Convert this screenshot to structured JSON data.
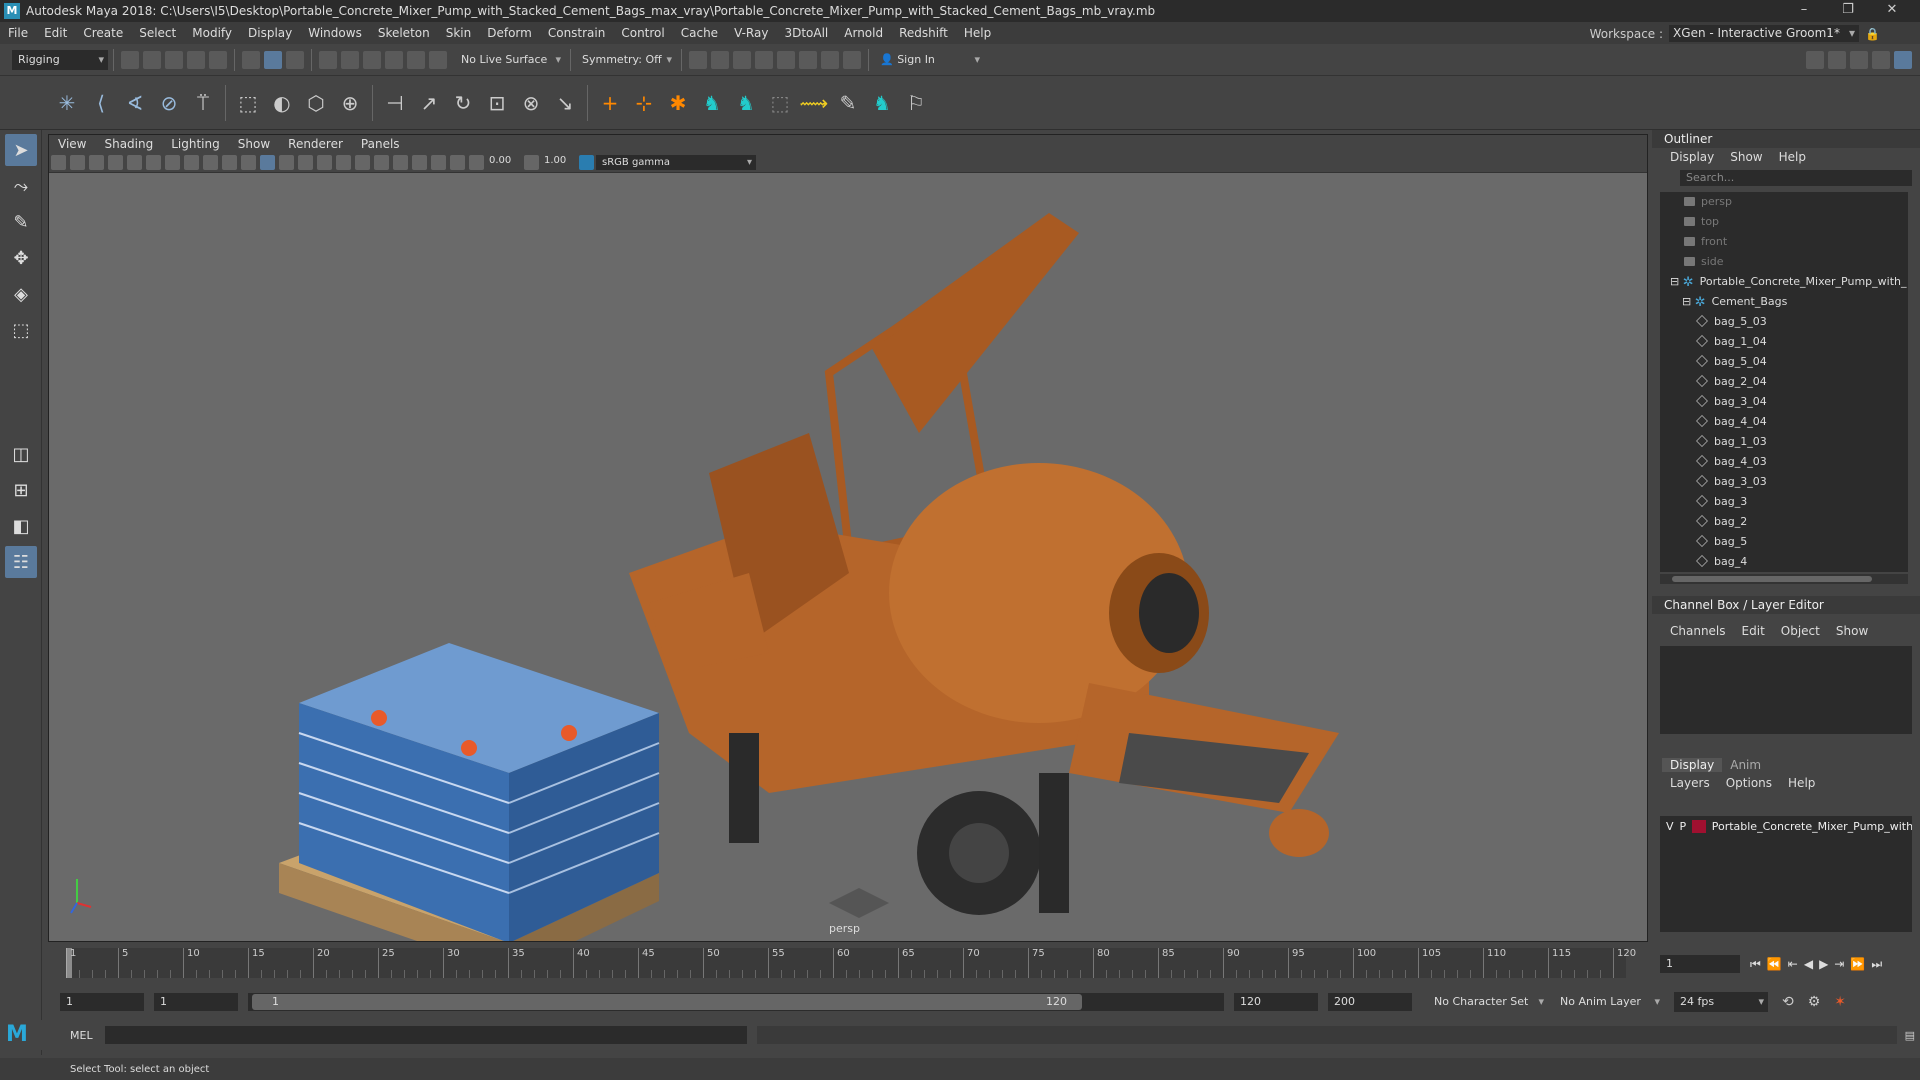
{
  "app": {
    "title": "Autodesk Maya 2018: C:\\Users\\I5\\Desktop\\Portable_Concrete_Mixer_Pump_with_Stacked_Cement_Bags_max_vray\\Portable_Concrete_Mixer_Pump_with_Stacked_Cement_Bags_mb_vray.mb",
    "logo_letter": "M"
  },
  "menubar": {
    "items": [
      "File",
      "Edit",
      "Create",
      "Select",
      "Modify",
      "Display",
      "Windows",
      "Skeleton",
      "Skin",
      "Deform",
      "Constrain",
      "Control",
      "Cache",
      "V-Ray",
      "3DtoAll",
      "Arnold",
      "Redshift",
      "Help"
    ],
    "workspace_label": "Workspace :",
    "workspace_value": "XGen - Interactive Groom1*"
  },
  "statusline": {
    "menuset": "Rigging",
    "live_surface": "No Live Surface",
    "symmetry": "Symmetry: Off",
    "sign_in": "Sign In"
  },
  "viewport": {
    "menu": [
      "View",
      "Shading",
      "Lighting",
      "Show",
      "Renderer",
      "Panels"
    ],
    "exposure": "0.00",
    "gamma": "1.00",
    "color_space": "sRGB gamma",
    "camera_label": "persp"
  },
  "outliner": {
    "title": "Outliner",
    "menu": [
      "Display",
      "Show",
      "Help"
    ],
    "search_placeholder": "Search...",
    "items": [
      {
        "label": "persp",
        "kind": "camera",
        "indent": 0,
        "dim": true
      },
      {
        "label": "top",
        "kind": "camera",
        "indent": 0,
        "dim": true
      },
      {
        "label": "front",
        "kind": "camera",
        "indent": 0,
        "dim": true
      },
      {
        "label": "side",
        "kind": "camera",
        "indent": 0,
        "dim": true
      },
      {
        "label": "Portable_Concrete_Mixer_Pump_with_",
        "kind": "group",
        "indent": 0,
        "dim": false
      },
      {
        "label": "Cement_Bags",
        "kind": "group",
        "indent": 1,
        "dim": false
      },
      {
        "label": "bag_5_03",
        "kind": "mesh",
        "indent": 2,
        "dim": false
      },
      {
        "label": "bag_1_04",
        "kind": "mesh",
        "indent": 2,
        "dim": false
      },
      {
        "label": "bag_5_04",
        "kind": "mesh",
        "indent": 2,
        "dim": false
      },
      {
        "label": "bag_2_04",
        "kind": "mesh",
        "indent": 2,
        "dim": false
      },
      {
        "label": "bag_3_04",
        "kind": "mesh",
        "indent": 2,
        "dim": false
      },
      {
        "label": "bag_4_04",
        "kind": "mesh",
        "indent": 2,
        "dim": false
      },
      {
        "label": "bag_1_03",
        "kind": "mesh",
        "indent": 2,
        "dim": false
      },
      {
        "label": "bag_4_03",
        "kind": "mesh",
        "indent": 2,
        "dim": false
      },
      {
        "label": "bag_3_03",
        "kind": "mesh",
        "indent": 2,
        "dim": false
      },
      {
        "label": "bag_3",
        "kind": "mesh",
        "indent": 2,
        "dim": false
      },
      {
        "label": "bag_2",
        "kind": "mesh",
        "indent": 2,
        "dim": false
      },
      {
        "label": "bag_5",
        "kind": "mesh",
        "indent": 2,
        "dim": false
      },
      {
        "label": "bag_4",
        "kind": "mesh",
        "indent": 2,
        "dim": false
      }
    ]
  },
  "channelbox": {
    "title": "Channel Box / Layer Editor",
    "menu": [
      "Channels",
      "Edit",
      "Object",
      "Show"
    ]
  },
  "layers": {
    "tabs": [
      "Display",
      "Anim"
    ],
    "menu": [
      "Layers",
      "Options",
      "Help"
    ],
    "rows": [
      {
        "v": "V",
        "p": "P",
        "name": "Portable_Concrete_Mixer_Pump_with_",
        "color": "#a01030"
      }
    ]
  },
  "timeline": {
    "ticks": [
      "1",
      "5",
      "10",
      "15",
      "20",
      "25",
      "30",
      "35",
      "40",
      "45",
      "50",
      "55",
      "60",
      "65",
      "70",
      "75",
      "80",
      "85",
      "90",
      "95",
      "100",
      "105",
      "110",
      "115",
      "120"
    ],
    "current_frame": "1"
  },
  "range": {
    "start": "1",
    "playback_start": "1",
    "slider_start": "1",
    "slider_end": "120",
    "playback_end": "120",
    "end": "200",
    "character_set": "No Character Set",
    "anim_layer": "No Anim Layer",
    "fps": "24 fps"
  },
  "cmdline": {
    "label": "MEL"
  },
  "helpline": {
    "text": "Select Tool: select an object"
  }
}
